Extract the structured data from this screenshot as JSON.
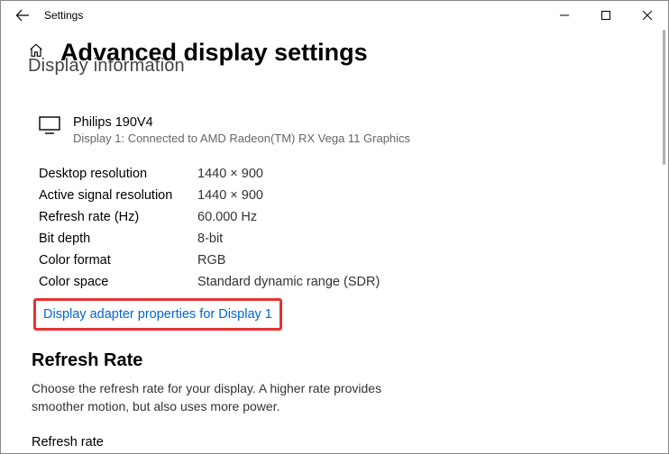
{
  "app": {
    "title": "Settings"
  },
  "page": {
    "title": "Advanced display settings",
    "truncatedHeading": "Display information"
  },
  "monitor": {
    "name": "Philips 190V4",
    "sub": "Display 1: Connected to AMD Radeon(TM) RX Vega 11 Graphics"
  },
  "specs": [
    {
      "label": "Desktop resolution",
      "value": "1440 × 900"
    },
    {
      "label": "Active signal resolution",
      "value": "1440 × 900"
    },
    {
      "label": "Refresh rate (Hz)",
      "value": "60.000 Hz"
    },
    {
      "label": "Bit depth",
      "value": "8-bit"
    },
    {
      "label": "Color format",
      "value": "RGB"
    },
    {
      "label": "Color space",
      "value": "Standard dynamic range (SDR)"
    }
  ],
  "link": {
    "text": "Display adapter properties for Display 1"
  },
  "refresh": {
    "heading": "Refresh Rate",
    "desc": "Choose the refresh rate for your display. A higher rate provides smoother motion, but also uses more power.",
    "label": "Refresh rate"
  }
}
